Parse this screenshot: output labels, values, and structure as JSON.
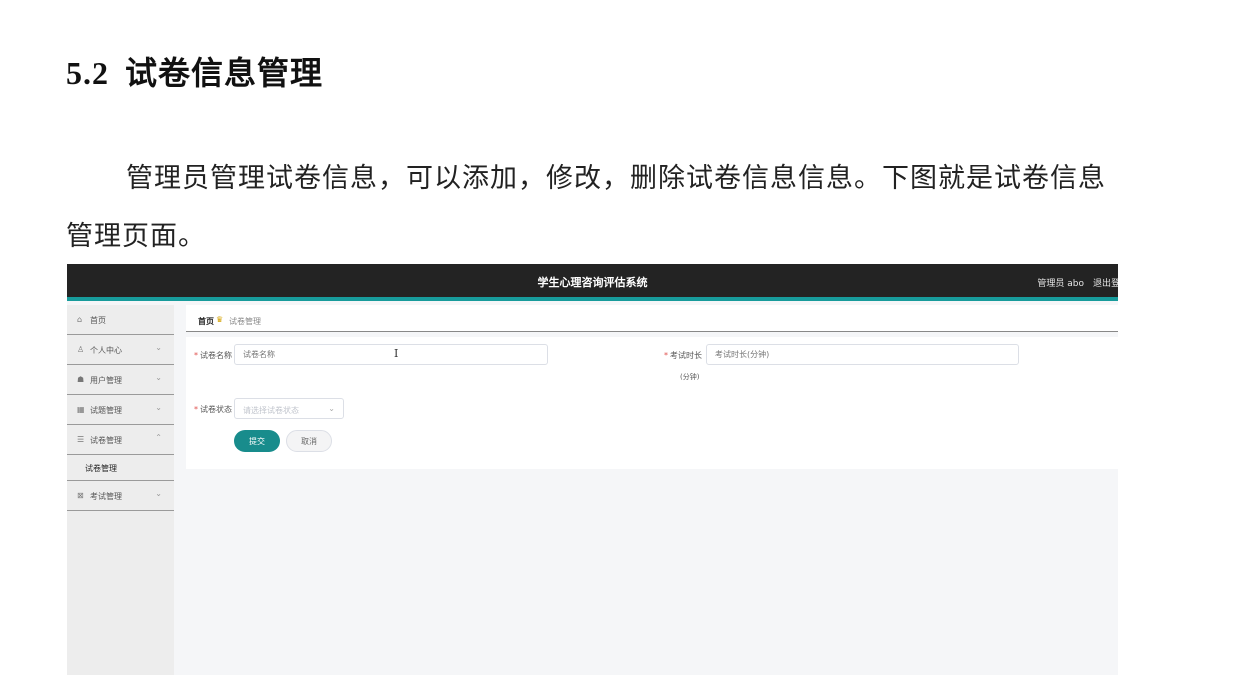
{
  "document": {
    "section_number": "5.2",
    "section_title": "试卷信息管理",
    "paragraph": "管理员管理试卷信息，可以添加，修改，删除试卷信息信息。下图就是试卷信息管理页面。"
  },
  "app": {
    "title": "学生心理咨询评估系统",
    "user_label": "管理员 abo",
    "logout_label": "退出登",
    "accent_color": "#179b9b",
    "header_color": "#232323"
  },
  "sidebar": {
    "items": [
      {
        "label": "首页",
        "icon": "home-icon"
      },
      {
        "label": "个人中心",
        "icon": "user-icon"
      },
      {
        "label": "用户管理",
        "icon": "group-icon"
      },
      {
        "label": "试题管理",
        "icon": "grid-icon"
      },
      {
        "label": "试卷管理",
        "icon": "list-icon"
      },
      {
        "label": "考试管理",
        "icon": "exam-icon"
      }
    ],
    "sub_item": "试卷管理"
  },
  "breadcrumb": {
    "home": "首页",
    "current": "试卷管理"
  },
  "form": {
    "name_label": "试卷名称",
    "name_placeholder": "试卷名称",
    "duration_label": "考试时长",
    "duration_placeholder": "考试时长(分钟)",
    "duration_unit": "(分钟)",
    "status_label": "试卷状态",
    "status_placeholder": "请选择试卷状态",
    "submit_label": "提交",
    "cancel_label": "取消"
  }
}
